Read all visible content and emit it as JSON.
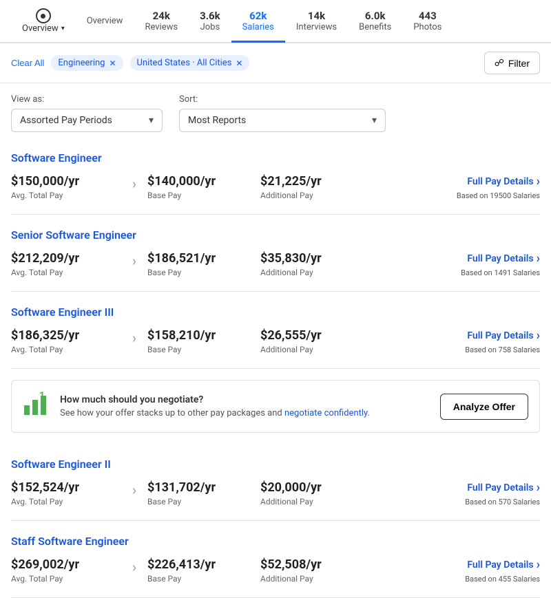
{
  "nav": {
    "tabs": [
      {
        "id": "overview",
        "label": "Overview",
        "count": null,
        "active": false
      },
      {
        "id": "reviews",
        "label": "Reviews",
        "count": "24k",
        "active": false
      },
      {
        "id": "jobs",
        "label": "Jobs",
        "count": "3.6k",
        "active": false
      },
      {
        "id": "salaries",
        "label": "Salaries",
        "count": "62k",
        "active": true
      },
      {
        "id": "interviews",
        "label": "Interviews",
        "count": "14k",
        "active": false
      },
      {
        "id": "benefits",
        "label": "Benefits",
        "count": "6.0k",
        "active": false
      },
      {
        "id": "photos",
        "label": "Photos",
        "count": "443",
        "active": false
      }
    ]
  },
  "filters": {
    "clear_all": "Clear All",
    "tags": [
      {
        "label": "Engineering",
        "id": "engineering"
      },
      {
        "label": "United States · All Cities",
        "id": "us-all-cities"
      }
    ],
    "filter_button": "Filter"
  },
  "controls": {
    "view_label": "View as:",
    "view_value": "Assorted Pay Periods",
    "sort_label": "Sort:",
    "sort_value": "Most Reports"
  },
  "jobs": [
    {
      "title": "Software Engineer",
      "avg_total_pay": "$150,000/yr",
      "avg_total_pay_label": "Avg. Total Pay",
      "base_pay": "$140,000/yr",
      "base_pay_label": "Base Pay",
      "additional_pay": "$21,225/yr",
      "additional_pay_label": "Additional Pay",
      "full_pay_label": "Full Pay Details",
      "based_on": "Based on 19500 Salaries"
    },
    {
      "title": "Senior Software Engineer",
      "avg_total_pay": "$212,209/yr",
      "avg_total_pay_label": "Avg. Total Pay",
      "base_pay": "$186,521/yr",
      "base_pay_label": "Base Pay",
      "additional_pay": "$35,830/yr",
      "additional_pay_label": "Additional Pay",
      "full_pay_label": "Full Pay Details",
      "based_on": "Based on 1491 Salaries"
    },
    {
      "title": "Software Engineer III",
      "avg_total_pay": "$186,325/yr",
      "avg_total_pay_label": "Avg. Total Pay",
      "base_pay": "$158,210/yr",
      "base_pay_label": "Base Pay",
      "additional_pay": "$26,555/yr",
      "additional_pay_label": "Additional Pay",
      "full_pay_label": "Full Pay Details",
      "based_on": "Based on 758 Salaries"
    },
    {
      "title": "Software Engineer II",
      "avg_total_pay": "$152,524/yr",
      "avg_total_pay_label": "Avg. Total Pay",
      "base_pay": "$131,702/yr",
      "base_pay_label": "Base Pay",
      "additional_pay": "$20,000/yr",
      "additional_pay_label": "Additional Pay",
      "full_pay_label": "Full Pay Details",
      "based_on": "Based on 570 Salaries"
    },
    {
      "title": "Staff Software Engineer",
      "avg_total_pay": "$269,002/yr",
      "avg_total_pay_label": "Avg. Total Pay",
      "base_pay": "$226,413/yr",
      "base_pay_label": "Base Pay",
      "additional_pay": "$52,508/yr",
      "additional_pay_label": "Additional Pay",
      "full_pay_label": "Full Pay Details",
      "based_on": "Based on 455 Salaries"
    }
  ],
  "analyze_banner": {
    "main_text": "How much should you negotiate?",
    "sub_text_before": "See how your offer stacks up to other pay packages and",
    "sub_text_link": "negotiate confidently",
    "button_label": "Analyze Offer"
  },
  "insert_after_index": 2
}
